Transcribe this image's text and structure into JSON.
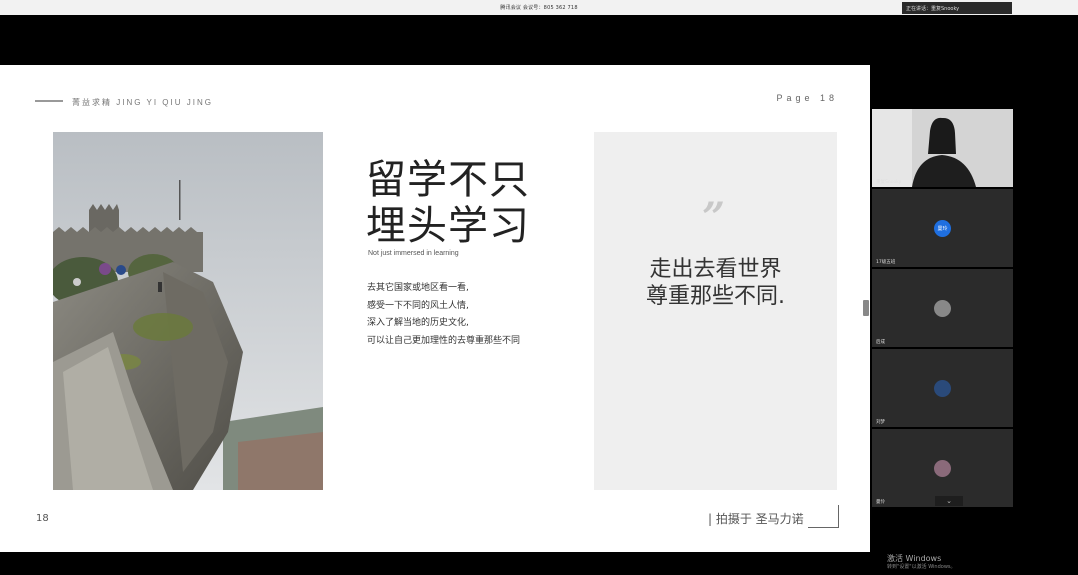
{
  "top_bar": {
    "meeting_title": "腾讯会议 会议号：805 362 718",
    "speaker": "正在讲话：重复Snooky"
  },
  "slide": {
    "brand": "菁益求精 JING YI QIU JING",
    "page_label": "Page 18",
    "headline_line1": "留学不只",
    "headline_line2": "埋头学习",
    "subtitle_en": "Not just immersed in learning",
    "body_lines": [
      "去其它国家或地区看一看,",
      "感受一下不同的风土人情,",
      "深入了解当地的历史文化,",
      "可以让自己更加理性的去尊重那些不同"
    ],
    "quote_mark": "”",
    "quote_line1": "走出去看世界",
    "quote_line2": "尊重那些不同.",
    "page_number": "18",
    "caption": "| 拍摄于 圣马力诺"
  },
  "participants": [
    {
      "name": "重复Snooky",
      "type": "video"
    },
    {
      "name": "17级五班",
      "avatar_text": "曼玲",
      "avatar_color": "#1f6fe0"
    },
    {
      "name": "后成",
      "avatar_text": "",
      "avatar_color": "#888888"
    },
    {
      "name": "刘梦",
      "avatar_text": "",
      "avatar_color": "#2a4a7a"
    },
    {
      "name": "曼伶",
      "avatar_text": "",
      "avatar_color": "#8a6a7a"
    }
  ],
  "collapse_icon": "chevron-down-icon",
  "watermark": {
    "title": "激活 Windows",
    "subtitle": "转到\"设置\"以激活 Windows。"
  }
}
